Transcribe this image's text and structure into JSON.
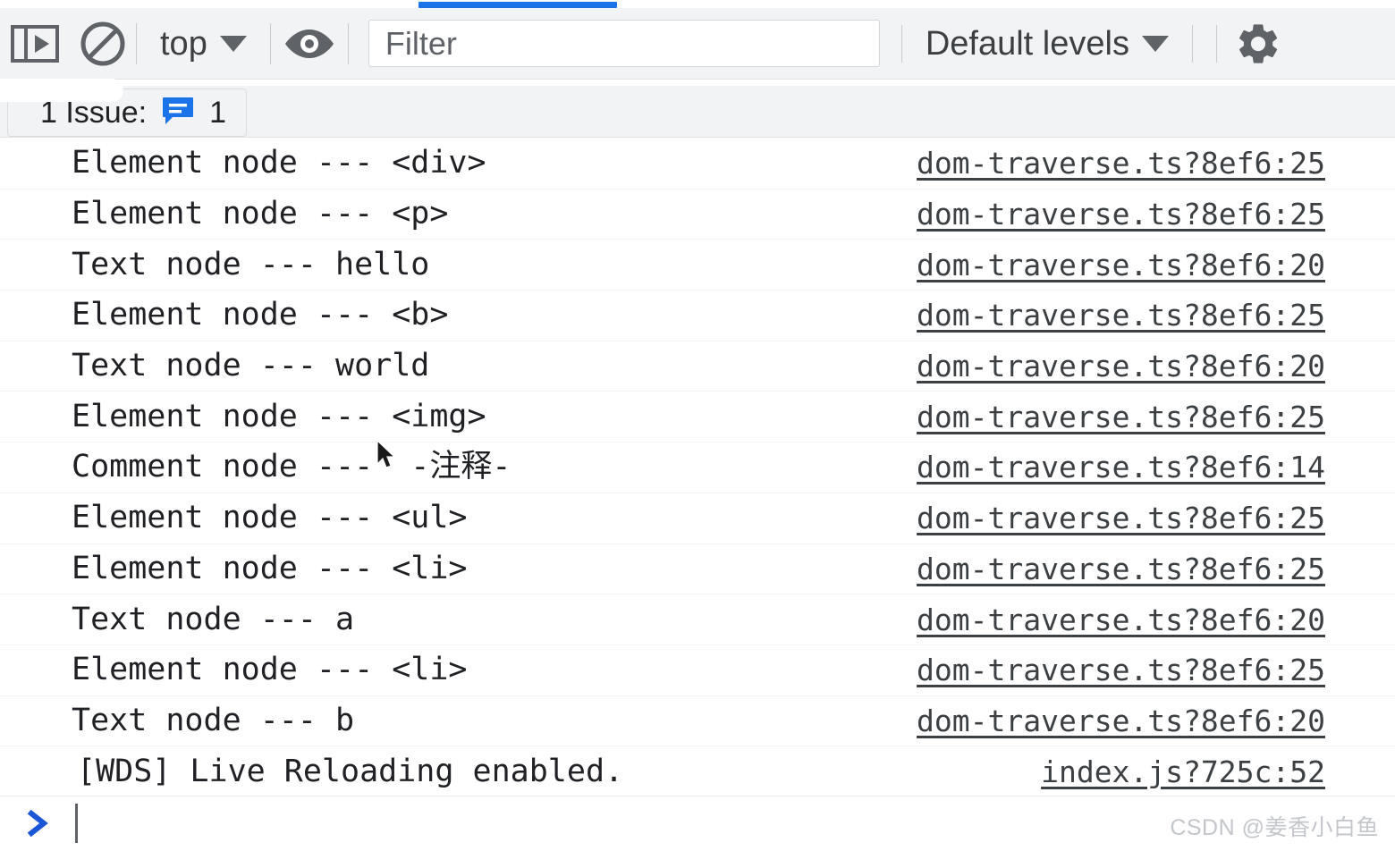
{
  "toolbar": {
    "sidebar_toggle_icon": "sidebar-panel-play-icon",
    "clear_console_icon": "no-entry-clear-icon",
    "context_selector": "top",
    "context_caret_icon": "chevron-down-icon",
    "eye_icon": "eye-live-expression-icon",
    "levels_selector": "Default levels",
    "levels_caret_icon": "chevron-down-icon",
    "settings_icon": "gear-icon"
  },
  "filter": {
    "value": "",
    "placeholder": "Filter"
  },
  "issues": {
    "label": "1 Issue:",
    "icon": "message-bubble-icon",
    "count": "1"
  },
  "prompt": {
    "arrow_icon": "chevron-right-prompt-icon",
    "value": "",
    "placeholder": ""
  },
  "watermark": "CSDN @姜香小白鱼",
  "colors": {
    "accent_blue": "#1a73e8",
    "toolbar_bg": "#f1f3f4",
    "text": "#202124",
    "link": "#3c4043"
  },
  "console_rows": [
    {
      "message": "Element node --- <div>",
      "source": "dom-traverse.ts?8ef6:25"
    },
    {
      "message": "Element node --- <p>",
      "source": "dom-traverse.ts?8ef6:25"
    },
    {
      "message": "Text node --- hello",
      "source": "dom-traverse.ts?8ef6:20"
    },
    {
      "message": "Element node --- <b>",
      "source": "dom-traverse.ts?8ef6:25"
    },
    {
      "message": "Text node --- world",
      "source": "dom-traverse.ts?8ef6:20"
    },
    {
      "message": "Element node --- <img>",
      "source": "dom-traverse.ts?8ef6:25"
    },
    {
      "message": "Comment node ---  -注释-",
      "source": "dom-traverse.ts?8ef6:14"
    },
    {
      "message": "Element node --- <ul>",
      "source": "dom-traverse.ts?8ef6:25"
    },
    {
      "message": "Element node --- <li>",
      "source": "dom-traverse.ts?8ef6:25"
    },
    {
      "message": "Text node --- a",
      "source": "dom-traverse.ts?8ef6:20"
    },
    {
      "message": "Element node --- <li>",
      "source": "dom-traverse.ts?8ef6:25"
    },
    {
      "message": "Text node --- b",
      "source": "dom-traverse.ts?8ef6:20"
    },
    {
      "message": "[WDS] Live Reloading enabled.",
      "source": "index.js?725c:52"
    }
  ]
}
